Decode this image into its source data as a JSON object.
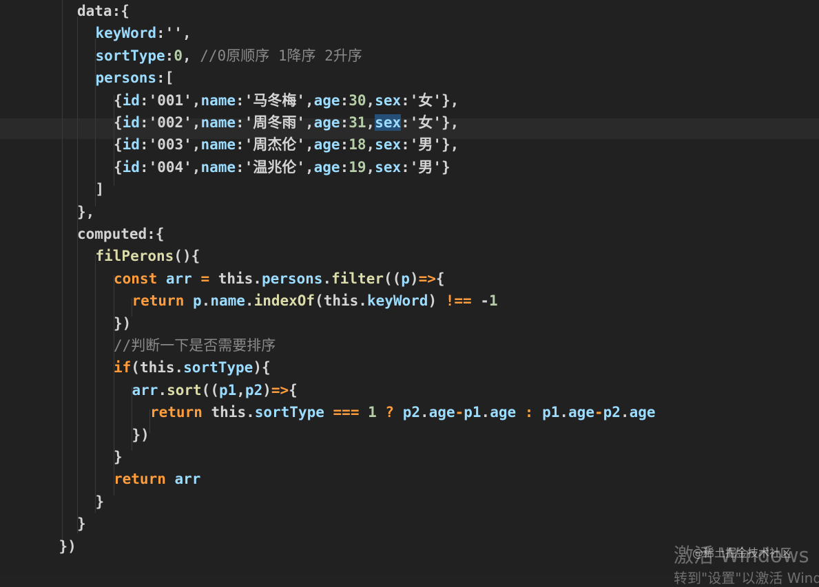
{
  "editor": {
    "lines": [
      {
        "indent": 0,
        "tokens": [
          [
            "plain",
            "data:{"
          ]
        ]
      },
      {
        "indent": 1,
        "tokens": [
          [
            "prop",
            "keyWord"
          ],
          [
            "plain",
            ":''"
          ],
          [
            "plain",
            ","
          ]
        ]
      },
      {
        "indent": 1,
        "tokens": [
          [
            "prop",
            "sortType"
          ],
          [
            "plain",
            ":"
          ],
          [
            "num",
            "0"
          ],
          [
            "plain",
            ", "
          ],
          [
            "comment",
            "//0原顺序 1降序 2升序"
          ]
        ]
      },
      {
        "indent": 1,
        "tokens": [
          [
            "prop",
            "persons"
          ],
          [
            "plain",
            ":["
          ]
        ]
      },
      {
        "indent": 2,
        "tokens": [
          [
            "plain",
            "{"
          ],
          [
            "prop",
            "id"
          ],
          [
            "plain",
            ":'001',"
          ],
          [
            "prop",
            "name"
          ],
          [
            "plain",
            ":'马冬梅',"
          ],
          [
            "prop",
            "age"
          ],
          [
            "plain",
            ":"
          ],
          [
            "num",
            "30"
          ],
          [
            "plain",
            ","
          ],
          [
            "prop",
            "sex"
          ],
          [
            "plain",
            ":'女'},"
          ]
        ]
      },
      {
        "indent": 2,
        "tokens": [
          [
            "plain",
            "{"
          ],
          [
            "prop",
            "id"
          ],
          [
            "plain",
            ":'002',"
          ],
          [
            "prop",
            "name"
          ],
          [
            "plain",
            ":'周冬雨',"
          ],
          [
            "prop",
            "age"
          ],
          [
            "plain",
            ":"
          ],
          [
            "num",
            "31"
          ],
          [
            "plain",
            ","
          ],
          [
            "sel",
            "sex"
          ],
          [
            "plain",
            ":'女'},"
          ]
        ]
      },
      {
        "indent": 2,
        "tokens": [
          [
            "plain",
            "{"
          ],
          [
            "prop",
            "id"
          ],
          [
            "plain",
            ":'003',"
          ],
          [
            "prop",
            "name"
          ],
          [
            "plain",
            ":'周杰伦',"
          ],
          [
            "prop",
            "age"
          ],
          [
            "plain",
            ":"
          ],
          [
            "num",
            "18"
          ],
          [
            "plain",
            ","
          ],
          [
            "prop",
            "sex"
          ],
          [
            "plain",
            ":'男'},"
          ]
        ]
      },
      {
        "indent": 2,
        "tokens": [
          [
            "plain",
            "{"
          ],
          [
            "prop",
            "id"
          ],
          [
            "plain",
            ":'004',"
          ],
          [
            "prop",
            "name"
          ],
          [
            "plain",
            ":'温兆伦',"
          ],
          [
            "prop",
            "age"
          ],
          [
            "plain",
            ":"
          ],
          [
            "num",
            "19"
          ],
          [
            "plain",
            ","
          ],
          [
            "prop",
            "sex"
          ],
          [
            "plain",
            ":'男'}"
          ]
        ]
      },
      {
        "indent": 1,
        "tokens": [
          [
            "plain",
            "]"
          ]
        ]
      },
      {
        "indent": 0,
        "tokens": [
          [
            "plain",
            "},"
          ]
        ]
      },
      {
        "indent": 0,
        "tokens": [
          [
            "plain",
            "computed:{"
          ]
        ]
      },
      {
        "indent": 1,
        "tokens": [
          [
            "fn",
            "filPerons"
          ],
          [
            "plain",
            "(){"
          ]
        ]
      },
      {
        "indent": 2,
        "tokens": [
          [
            "kw",
            "const "
          ],
          [
            "ident",
            "arr"
          ],
          [
            "op",
            " = "
          ],
          [
            "plain",
            "this."
          ],
          [
            "prop",
            "persons"
          ],
          [
            "plain",
            "."
          ],
          [
            "fn",
            "filter"
          ],
          [
            "plain",
            "(("
          ],
          [
            "ident",
            "p"
          ],
          [
            "plain",
            ")"
          ],
          [
            "op",
            "=>"
          ],
          [
            "plain",
            "{"
          ]
        ]
      },
      {
        "indent": 3,
        "tokens": [
          [
            "kw",
            "return "
          ],
          [
            "ident",
            "p"
          ],
          [
            "plain",
            "."
          ],
          [
            "prop",
            "name"
          ],
          [
            "plain",
            "."
          ],
          [
            "fn",
            "indexOf"
          ],
          [
            "plain",
            "(this."
          ],
          [
            "prop",
            "keyWord"
          ],
          [
            "plain",
            ") "
          ],
          [
            "op",
            "!=="
          ],
          [
            "plain",
            " -"
          ],
          [
            "num",
            "1"
          ]
        ]
      },
      {
        "indent": 2,
        "tokens": [
          [
            "plain",
            "})"
          ]
        ]
      },
      {
        "indent": 2,
        "tokens": [
          [
            "comment",
            "//判断一下是否需要排序"
          ]
        ]
      },
      {
        "indent": 2,
        "tokens": [
          [
            "kw",
            "if"
          ],
          [
            "plain",
            "(this."
          ],
          [
            "prop",
            "sortType"
          ],
          [
            "plain",
            "){"
          ]
        ]
      },
      {
        "indent": 3,
        "tokens": [
          [
            "ident",
            "arr"
          ],
          [
            "plain",
            "."
          ],
          [
            "fn",
            "sort"
          ],
          [
            "plain",
            "(("
          ],
          [
            "ident",
            "p1"
          ],
          [
            "plain",
            ","
          ],
          [
            "ident",
            "p2"
          ],
          [
            "plain",
            ")"
          ],
          [
            "op",
            "=>"
          ],
          [
            "plain",
            "{"
          ]
        ]
      },
      {
        "indent": 4,
        "tokens": [
          [
            "kw",
            "return "
          ],
          [
            "plain",
            "this."
          ],
          [
            "prop",
            "sortType"
          ],
          [
            "op",
            " === "
          ],
          [
            "num",
            "1"
          ],
          [
            "op",
            " ? "
          ],
          [
            "ident",
            "p2"
          ],
          [
            "plain",
            "."
          ],
          [
            "prop",
            "age"
          ],
          [
            "op",
            "-"
          ],
          [
            "ident",
            "p1"
          ],
          [
            "plain",
            "."
          ],
          [
            "prop",
            "age"
          ],
          [
            "op",
            " : "
          ],
          [
            "ident",
            "p1"
          ],
          [
            "plain",
            "."
          ],
          [
            "prop",
            "age"
          ],
          [
            "op",
            "-"
          ],
          [
            "ident",
            "p2"
          ],
          [
            "plain",
            "."
          ],
          [
            "prop",
            "age"
          ]
        ]
      },
      {
        "indent": 3,
        "tokens": [
          [
            "plain",
            "})"
          ]
        ]
      },
      {
        "indent": 2,
        "tokens": [
          [
            "plain",
            "}"
          ]
        ]
      },
      {
        "indent": 2,
        "tokens": [
          [
            "kw",
            "return "
          ],
          [
            "ident",
            "arr"
          ]
        ]
      },
      {
        "indent": 1,
        "tokens": [
          [
            "plain",
            "}"
          ]
        ]
      },
      {
        "indent": 0,
        "tokens": [
          [
            "plain",
            "}"
          ]
        ]
      },
      {
        "indent": -1,
        "tokens": [
          [
            "plain",
            "})"
          ]
        ]
      }
    ],
    "current_line_index": 5,
    "colors": {
      "background": "#212121",
      "current_line": "#2a2a2a",
      "selection": "#264f78"
    }
  },
  "watermark": {
    "activate_title": "激活 Windows",
    "activate_sub": "转到\"设置\"以激活 Windows。",
    "community": "@稀土掘金技术社区"
  }
}
